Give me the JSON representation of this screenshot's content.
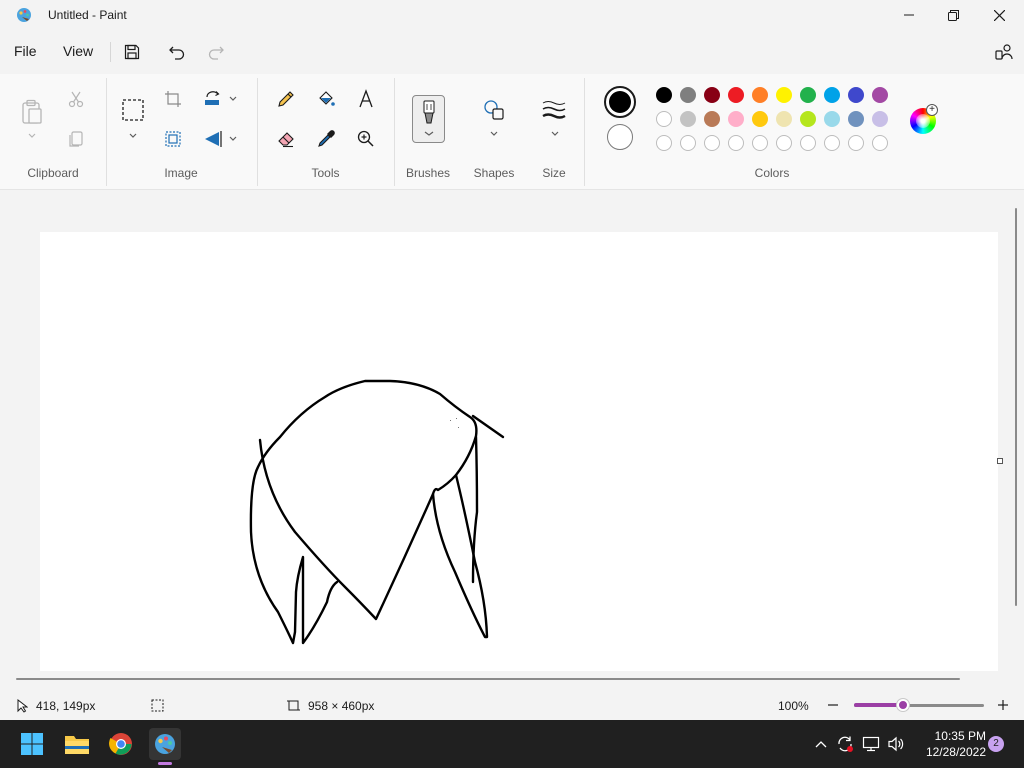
{
  "window": {
    "title": "Untitled - Paint"
  },
  "menu": {
    "file_label": "File",
    "view_label": "View"
  },
  "ribbon": {
    "groups": {
      "clipboard": "Clipboard",
      "image": "Image",
      "tools": "Tools",
      "brushes": "Brushes",
      "shapes": "Shapes",
      "size": "Size",
      "colors": "Colors"
    }
  },
  "colors": {
    "primary": "#000000",
    "secondary": "#ffffff",
    "palette_row1": [
      "#000000",
      "#7f7f7f",
      "#880015",
      "#ed1c24",
      "#ff7f27",
      "#fff200",
      "#22b14c",
      "#00a2e8",
      "#3f48cc",
      "#a349a4"
    ],
    "palette_row2": [
      "#ffffff",
      "#c3c3c3",
      "#b97a57",
      "#ffaec9",
      "#ffc90e",
      "#efe4b0",
      "#b5e61d",
      "#99d9ea",
      "#7092be",
      "#c8bfe7"
    ]
  },
  "status": {
    "cursor_position": "418, 149px",
    "canvas_size": "958 × 460px",
    "zoom": "100%",
    "zoom_fraction": 0.38
  },
  "taskbar": {
    "time": "10:35 PM",
    "date": "12/28/2022",
    "notification_count": "2"
  }
}
